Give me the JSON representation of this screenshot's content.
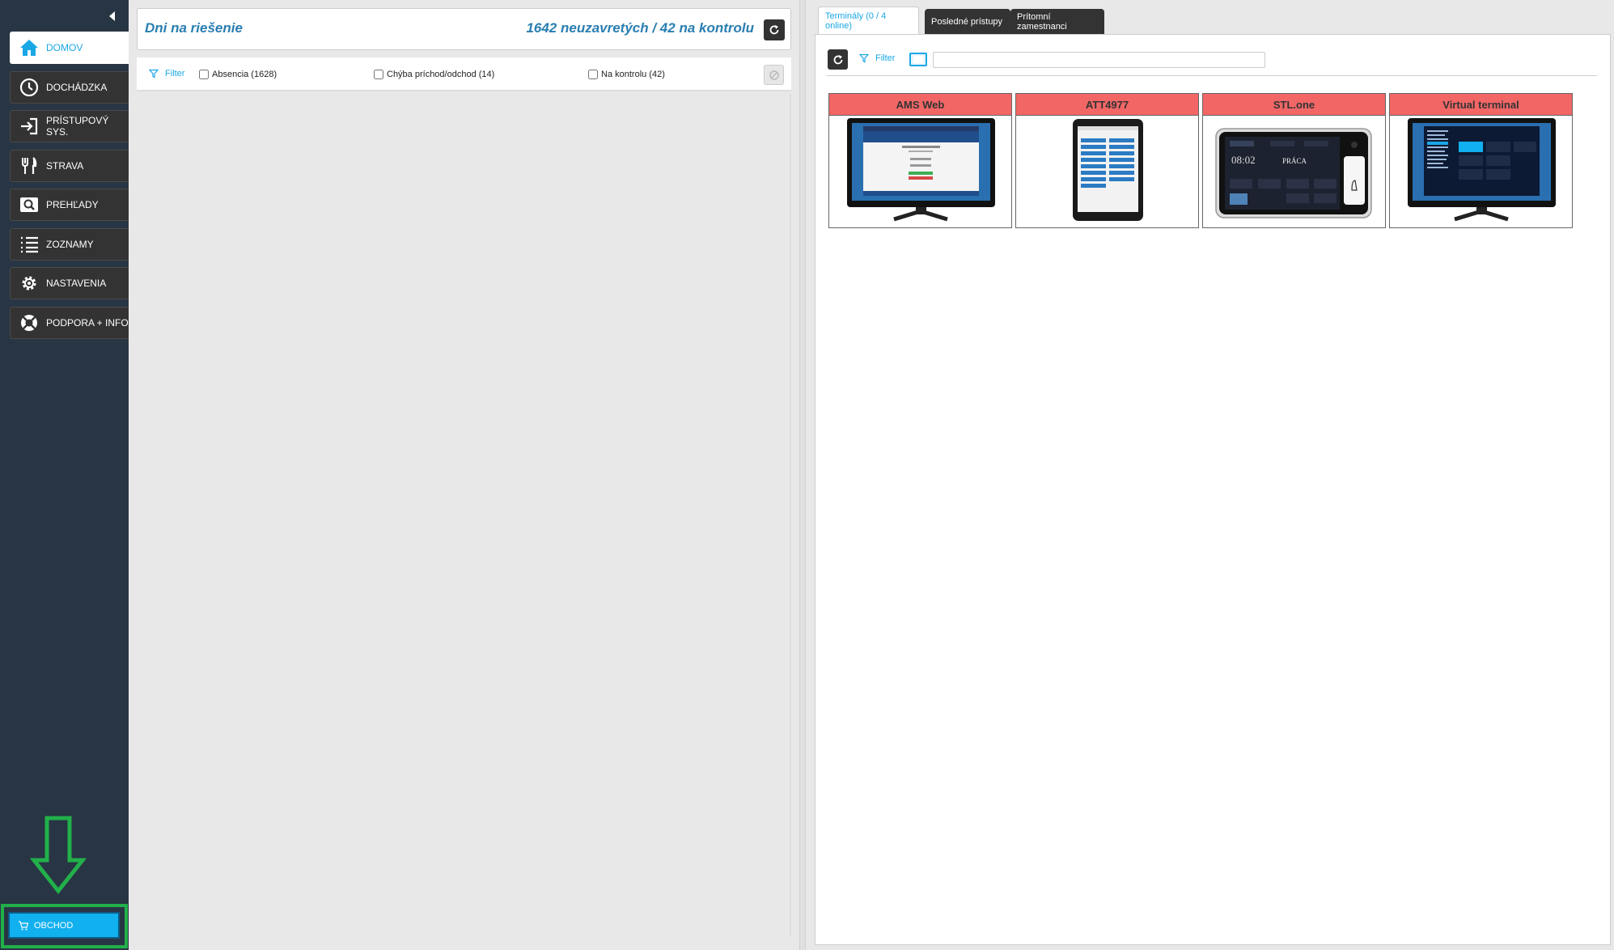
{
  "sidebar": {
    "items": [
      {
        "label": "DOMOV",
        "icon": "home-icon"
      },
      {
        "label": "DOCHÁDZKA",
        "icon": "clock-icon"
      },
      {
        "label": "PRÍSTUPOVÝ SYS.",
        "icon": "sign-in-icon"
      },
      {
        "label": "STRAVA",
        "icon": "cutlery-icon"
      },
      {
        "label": "PREHĽADY",
        "icon": "magnifier-icon"
      },
      {
        "label": "ZOZNAMY",
        "icon": "list-icon"
      },
      {
        "label": "NASTAVENIA",
        "icon": "gear-icon"
      },
      {
        "label": "PODPORA + INFO",
        "icon": "lifebuoy-icon"
      }
    ],
    "shop": {
      "label": "OBCHOD",
      "icon": "cart-icon"
    },
    "active_index": 0
  },
  "middle": {
    "title": "Dni na riešenie",
    "count": "1642 neuzavretých / 42 na kontrolu",
    "filter_label": "Filter",
    "checkboxes": [
      {
        "label": "Absencia (1628)",
        "checked": false
      },
      {
        "label": "Chýba príchod/odchod (14)",
        "checked": false
      },
      {
        "label": "Na kontrolu (42)",
        "checked": false
      }
    ]
  },
  "right": {
    "tabs": [
      {
        "label": "Terminály (0 / 4 online)",
        "active": true
      },
      {
        "label": "Posledné prístupy",
        "active": false
      },
      {
        "label": "Prítomní zamestnanci",
        "active": false
      }
    ],
    "filter_label": "Filter",
    "search": {
      "value": "",
      "placeholder": ""
    },
    "terminals": [
      {
        "name": "AMS Web",
        "device": "monitor",
        "status": "offline"
      },
      {
        "name": "ATT4977",
        "device": "tablet",
        "status": "offline"
      },
      {
        "name": "STL.one",
        "device": "terminal",
        "status": "offline"
      },
      {
        "name": "Virtual terminal",
        "device": "monitor",
        "status": "offline"
      }
    ]
  },
  "colors": {
    "sidebar_bg": "#283544",
    "accent": "#1aa7e6",
    "offline": "#f26666",
    "highlight": "#22b04a"
  }
}
